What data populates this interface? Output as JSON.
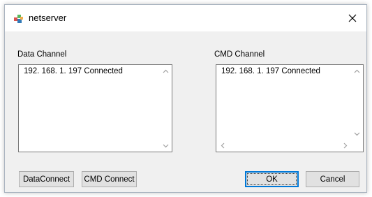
{
  "window": {
    "title": "netserver",
    "close_label": "×"
  },
  "data_channel": {
    "label": "Data Channel",
    "items": [
      "192. 168. 1. 197 Connected"
    ]
  },
  "cmd_channel": {
    "label": "CMD Channel",
    "items": [
      "192. 168. 1. 197 Connected"
    ]
  },
  "buttons": {
    "data_connect": "DataConnect",
    "cmd_connect": "CMD Connect",
    "ok": "OK",
    "cancel": "Cancel"
  },
  "colors": {
    "accent": "#0078d7",
    "dialog_bg": "#f0f0f0",
    "list_border": "#7a7a7a",
    "scroll_arrow": "#a0a0a0"
  },
  "icons": {
    "app": "app-network-icon",
    "close": "close-icon"
  }
}
